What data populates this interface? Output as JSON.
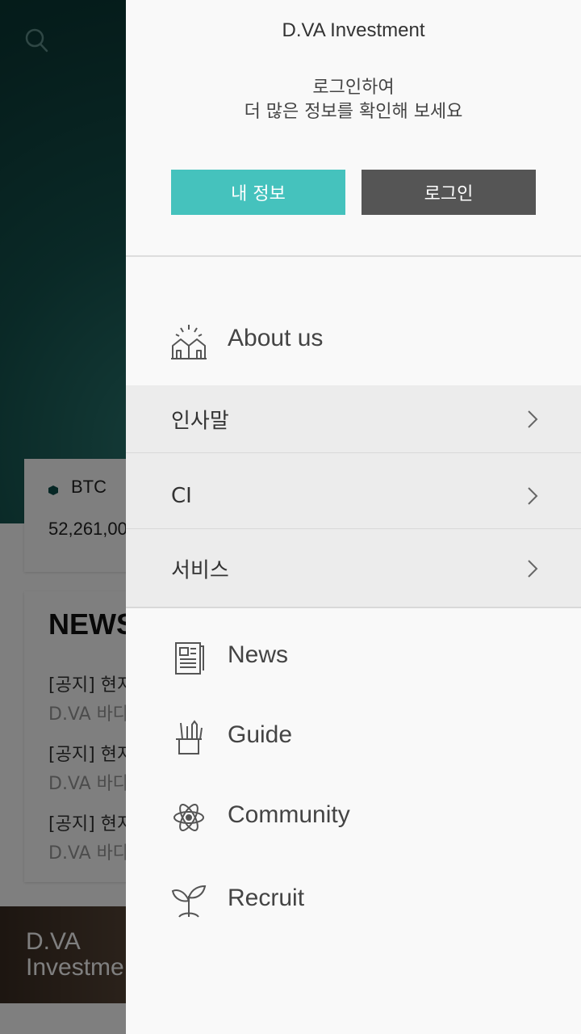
{
  "background": {
    "ticker": {
      "name": "BTC",
      "price": "52,261,00"
    },
    "news": {
      "title": "NEWS",
      "items": [
        {
          "title": "[공지] 현지",
          "source": "D.VA 바다"
        },
        {
          "title": "[공지] 현지",
          "source": "D.VA 바다"
        },
        {
          "title": "[공지] 현지",
          "source": "D.VA 바다"
        }
      ]
    },
    "banner": {
      "line1": "D.VA",
      "line2": "Investme"
    }
  },
  "drawer": {
    "brand": "D.VA Investment",
    "login_message_line1": "로그인하여",
    "login_message_line2": "더 많은 정보를 확인해 보세요",
    "my_info_label": "내 정보",
    "login_label": "로그인",
    "about": {
      "label": "About us",
      "icon": "buildings-icon"
    },
    "about_sub": [
      {
        "label": "인사말"
      },
      {
        "label": "CI"
      },
      {
        "label": "서비스"
      }
    ],
    "menu": [
      {
        "label": "News",
        "icon": "newspaper-icon"
      },
      {
        "label": "Guide",
        "icon": "pencil-cup-icon"
      },
      {
        "label": "Community",
        "icon": "atom-icon"
      },
      {
        "label": "Recruit",
        "icon": "sprout-icon"
      }
    ]
  },
  "colors": {
    "accent": "#45c2bd",
    "dark_button": "#555555",
    "hero": "#0b3a37"
  }
}
